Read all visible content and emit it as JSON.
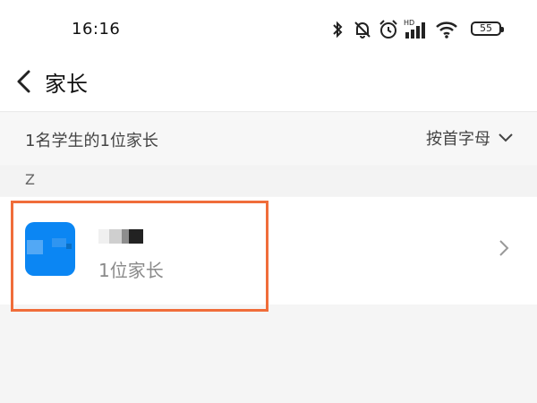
{
  "status_bar": {
    "time": "16:16",
    "battery_level": "55",
    "icons": [
      "bluetooth-icon",
      "mute-bell-icon",
      "alarm-icon",
      "hd-signal-icon",
      "wifi-icon",
      "battery-icon"
    ]
  },
  "navbar": {
    "title": "家长"
  },
  "summary": {
    "count_text": "1名学生的1位家长",
    "sort_label": "按首字母"
  },
  "sections": [
    {
      "letter": "Z",
      "items": [
        {
          "name": "",
          "subtitle": "1位家长"
        }
      ]
    }
  ],
  "colors": {
    "avatar": "#0b86f3",
    "highlight": "#f06d3a",
    "page_background": "#f5f5f5"
  }
}
